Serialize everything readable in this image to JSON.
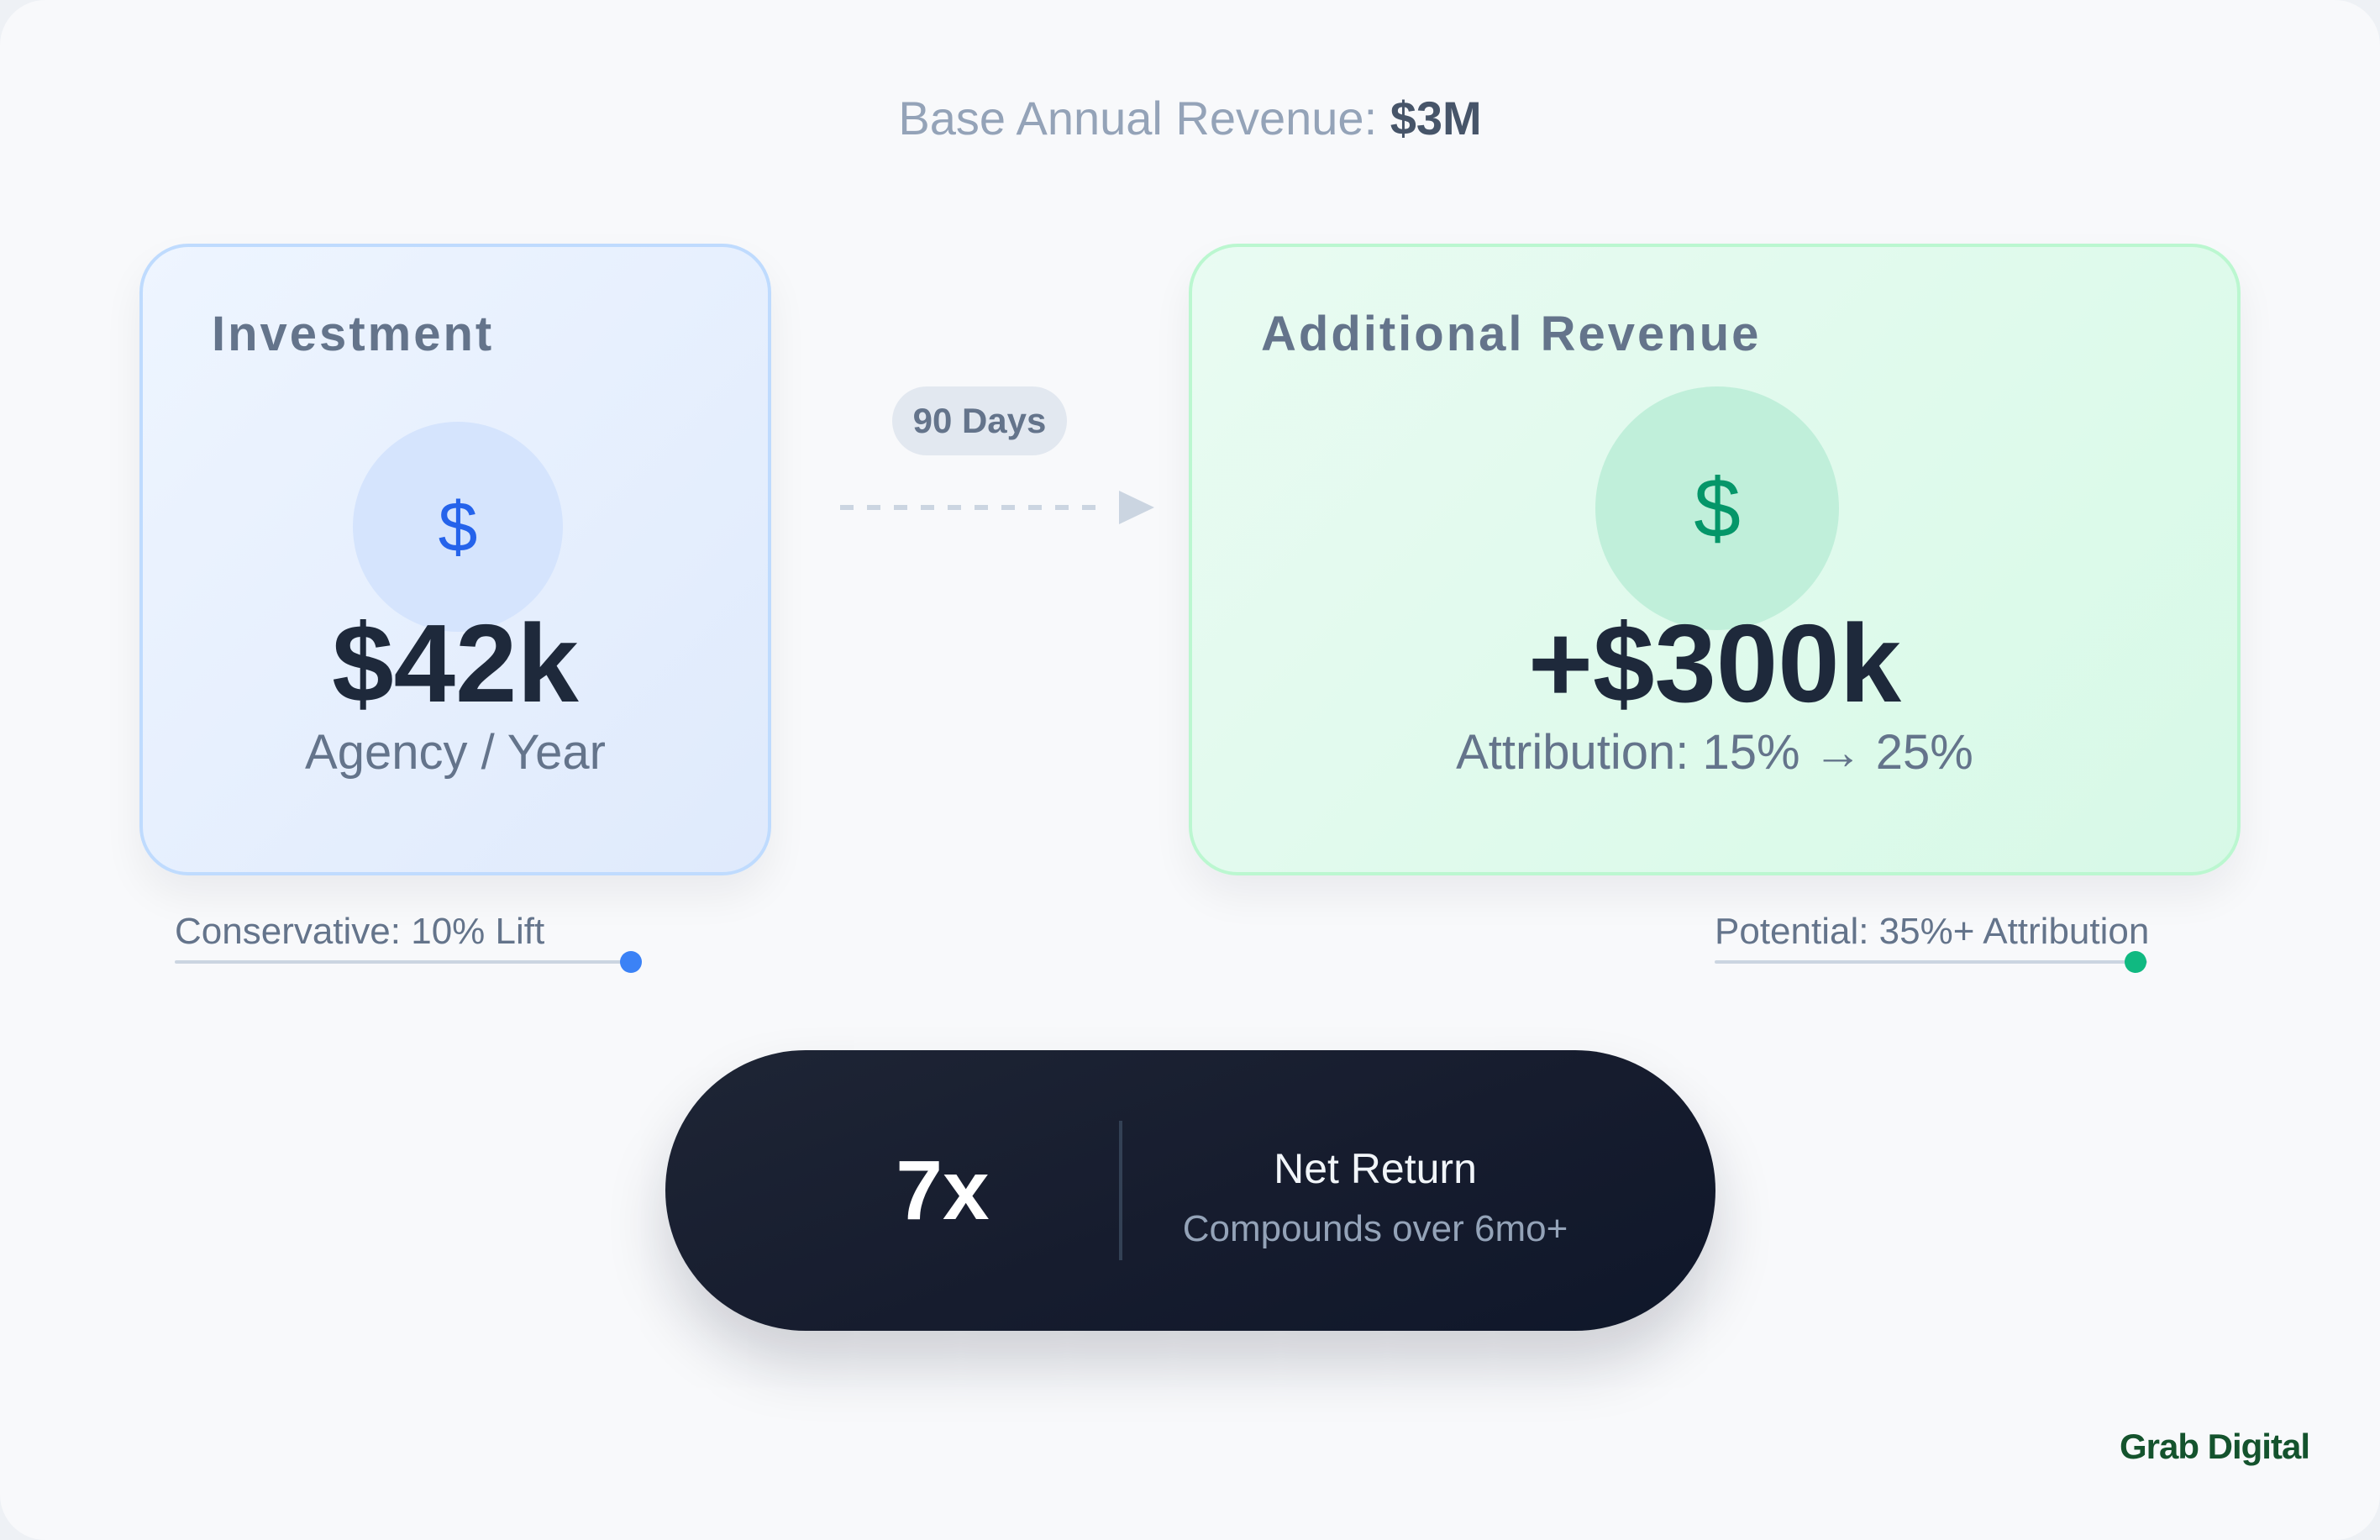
{
  "header": {
    "label": "Base Annual Revenue:",
    "value": "$3M"
  },
  "investment": {
    "title": "Investment",
    "icon": "$",
    "value": "$42k",
    "subtitle": "Agency / Year"
  },
  "revenue": {
    "title": "Additional Revenue",
    "icon": "$",
    "value": "+$300k",
    "subtitle": "Attribution: 15% → 25%"
  },
  "connector": {
    "label": "90 Days"
  },
  "sliders": {
    "conservative": {
      "label": "Conservative: 10% Lift",
      "color": "#3b82f6"
    },
    "potential": {
      "label": "Potential: 35%+ Attribution",
      "color": "#10b981"
    }
  },
  "result": {
    "multiplier": "7x",
    "label": "Net Return",
    "sublabel": "Compounds over 6mo+"
  },
  "brand": "Grab Digital",
  "colors": {
    "investment_accent": "#2563eb",
    "revenue_accent": "#059669",
    "dark": "#0f172a"
  }
}
